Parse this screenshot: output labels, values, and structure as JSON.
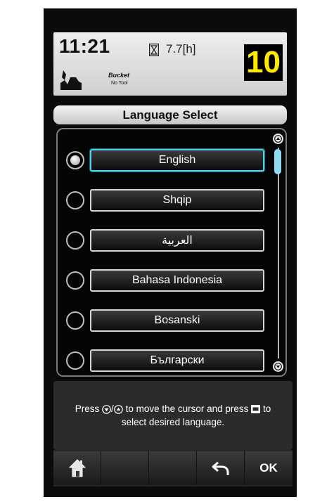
{
  "status": {
    "time": "11:21",
    "hour_meter": "7.7[h]",
    "attachment": "Bucket",
    "tool": "No Tool",
    "gear": "10",
    "gear_color": "#ffe800"
  },
  "screen_title": "Language Select",
  "languages": [
    {
      "label": "English",
      "selected": true,
      "focused": true
    },
    {
      "label": "Shqip",
      "selected": false,
      "focused": false
    },
    {
      "label": "العربية",
      "selected": false,
      "focused": false
    },
    {
      "label": "Bahasa Indonesia",
      "selected": false,
      "focused": false
    },
    {
      "label": "Bosanski",
      "selected": false,
      "focused": false
    },
    {
      "label": "Български",
      "selected": false,
      "focused": false
    }
  ],
  "help": {
    "part1": "Press",
    "part2": "to move the cursor and press",
    "part3": "to",
    "part4": "select desired language."
  },
  "toolbar": {
    "home_icon": "home-icon",
    "back_icon": "return-arrow-icon",
    "ok_label": "OK"
  },
  "colors": {
    "focus": "#4fd2ea",
    "scroll_thumb": "#8fdaf0"
  }
}
